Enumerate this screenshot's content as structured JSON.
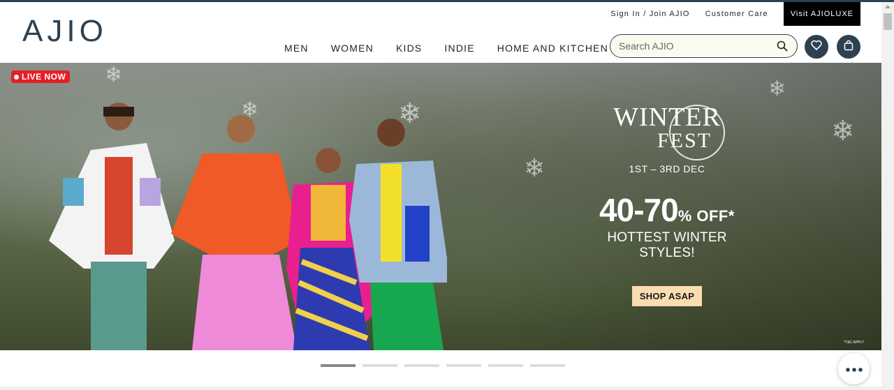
{
  "header": {
    "logo": "AJIO",
    "util_links": [
      "Sign In / Join AJIO",
      "Customer Care"
    ],
    "luxe_button": "Visit AJIOLUXE",
    "nav": [
      "MEN",
      "WOMEN",
      "KIDS",
      "INDIE",
      "HOME AND KITCHEN"
    ],
    "search": {
      "placeholder": "Search AJIO",
      "value": ""
    },
    "icons": {
      "search": "search-icon",
      "wishlist": "heart-icon",
      "bag": "shopping-bag-icon"
    }
  },
  "banner": {
    "live_badge": "LIVE NOW",
    "promo_line1": "WINTER",
    "promo_line2": "FEST",
    "dates": "1ST – 3RD DEC",
    "discount": "40-70",
    "discount_suffix": "% OFF*",
    "tagline": "HOTTEST WINTER STYLES!",
    "cta": "SHOP ASAP",
    "tnc": "*T&C APPLY",
    "slides_total": 6,
    "active_slide": 1
  },
  "colors": {
    "brand": "#2c4152",
    "live_red": "#e41f28",
    "cta_bg": "#f9dcb0",
    "luxe_bg": "#000000"
  },
  "chat": {
    "icon": "more-dots-icon"
  }
}
